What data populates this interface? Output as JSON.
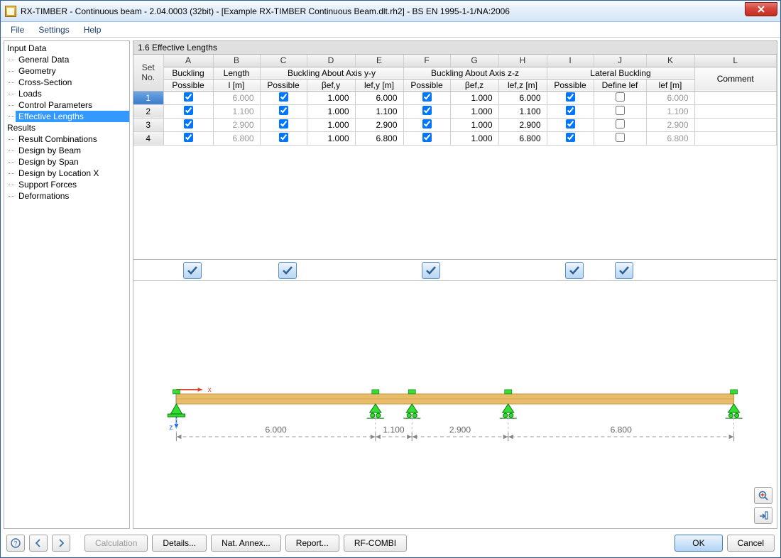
{
  "window": {
    "title": "RX-TIMBER - Continuous beam - 2.04.0003 (32bit) - [Example RX-TIMBER Continuous Beam.dlt.rh2] - BS EN 1995-1-1/NA:2006"
  },
  "menus": {
    "file": "File",
    "settings": "Settings",
    "help": "Help"
  },
  "tree": {
    "input_data": "Input Data",
    "general_data": "General Data",
    "geometry": "Geometry",
    "cross_section": "Cross-Section",
    "loads": "Loads",
    "control_parameters": "Control Parameters",
    "effective_lengths": "Effective Lengths",
    "results": "Results",
    "result_combinations": "Result Combinations",
    "design_by_beam": "Design by Beam",
    "design_by_span": "Design by Span",
    "design_by_location_x": "Design by Location X",
    "support_forces": "Support Forces",
    "deformations": "Deformations"
  },
  "panel": {
    "title": "1.6 Effective Lengths"
  },
  "letters": [
    "A",
    "B",
    "C",
    "D",
    "E",
    "F",
    "G",
    "H",
    "I",
    "J",
    "K",
    "L"
  ],
  "headers": {
    "set_no_top": "Set",
    "set_no_bot": "No.",
    "buckling": "Buckling",
    "possible": "Possible",
    "length": "Length",
    "l_m": "l [m]",
    "buckling_yy": "Buckling About Axis y-y",
    "beta_efy": "βef,y",
    "l_efy": "lef,y [m]",
    "buckling_zz": "Buckling About Axis z-z",
    "beta_efz": "βef,z",
    "l_efz": "lef,z [m]",
    "lateral_buckling": "Lateral Buckling",
    "define_lef": "Define lef",
    "l_ef": "lef [m]",
    "comment": "Comment"
  },
  "rows": [
    {
      "set": "1",
      "buckling": true,
      "l": "6.000",
      "yy_pos": true,
      "beta_y": "1.000",
      "lef_y": "6.000",
      "zz_pos": true,
      "beta_z": "1.000",
      "lef_z": "6.000",
      "lb_pos": true,
      "define_lef": false,
      "lef": "6.000",
      "comment": ""
    },
    {
      "set": "2",
      "buckling": true,
      "l": "1.100",
      "yy_pos": true,
      "beta_y": "1.000",
      "lef_y": "1.100",
      "zz_pos": true,
      "beta_z": "1.000",
      "lef_z": "1.100",
      "lb_pos": true,
      "define_lef": false,
      "lef": "1.100",
      "comment": ""
    },
    {
      "set": "3",
      "buckling": true,
      "l": "2.900",
      "yy_pos": true,
      "beta_y": "1.000",
      "lef_y": "2.900",
      "zz_pos": true,
      "beta_z": "1.000",
      "lef_z": "2.900",
      "lb_pos": true,
      "define_lef": false,
      "lef": "2.900",
      "comment": ""
    },
    {
      "set": "4",
      "buckling": true,
      "l": "6.800",
      "yy_pos": true,
      "beta_y": "1.000",
      "lef_y": "6.800",
      "zz_pos": true,
      "beta_z": "1.000",
      "lef_z": "6.800",
      "lb_pos": true,
      "define_lef": false,
      "lef": "6.800",
      "comment": ""
    }
  ],
  "selected_row": 0,
  "diagram": {
    "spans": [
      "6.000",
      "1.100",
      "2.900",
      "6.800"
    ]
  },
  "buttons": {
    "calculation": "Calculation",
    "details": "Details...",
    "nat_annex": "Nat. Annex...",
    "report": "Report...",
    "rf_combi": "RF-COMBI",
    "ok": "OK",
    "cancel": "Cancel"
  }
}
